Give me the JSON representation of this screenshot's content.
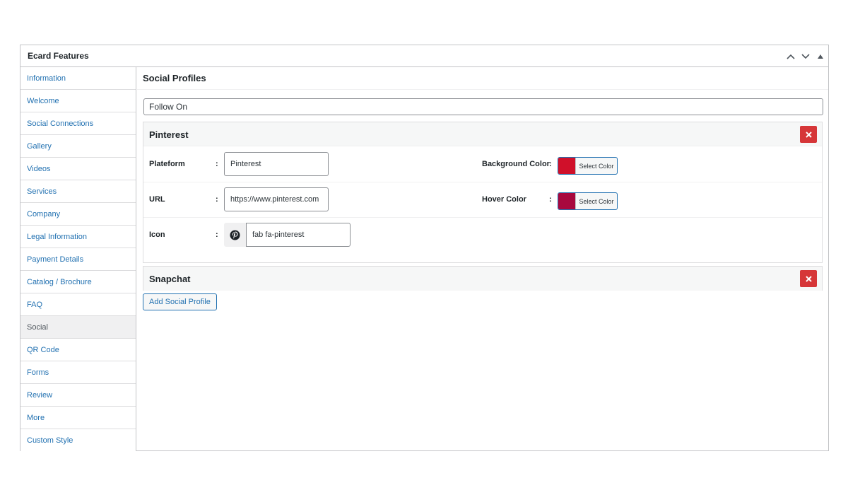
{
  "panel": {
    "title": "Ecard Features",
    "controls": [
      "chevron-up-icon",
      "chevron-down-icon",
      "triangle-up-icon"
    ]
  },
  "sidebar": {
    "items": [
      {
        "label": "Information"
      },
      {
        "label": "Welcome"
      },
      {
        "label": "Social Connections"
      },
      {
        "label": "Gallery"
      },
      {
        "label": "Videos"
      },
      {
        "label": "Services"
      },
      {
        "label": "Company"
      },
      {
        "label": "Legal Information"
      },
      {
        "label": "Payment Details"
      },
      {
        "label": "Catalog / Brochure"
      },
      {
        "label": "FAQ"
      },
      {
        "label": "Social",
        "active": true
      },
      {
        "label": "QR Code"
      },
      {
        "label": "Forms"
      },
      {
        "label": "Review"
      },
      {
        "label": "More"
      },
      {
        "label": "Custom Style"
      }
    ]
  },
  "main": {
    "title": "Social Profiles",
    "follow_value": "Follow On",
    "profiles": [
      {
        "name": "Pinterest",
        "platform_label": "Plateform",
        "platform_value": "Pinterest",
        "url_label": "URL",
        "url_value": "https://www.pinterest.com",
        "icon_label": "Icon",
        "icon_value": "fab fa-pinterest",
        "bg_color_label": "Background Color",
        "hover_color_label": "Hover Color",
        "select_color_label": "Select Color",
        "colon": ":"
      },
      {
        "name": "Snapchat"
      }
    ],
    "add_button": "Add Social Profile"
  },
  "colors": {
    "accent": "#2271b1",
    "remove": "#d63638",
    "bg_swatch": "#d0102a",
    "hover_swatch": "#a8083e"
  }
}
